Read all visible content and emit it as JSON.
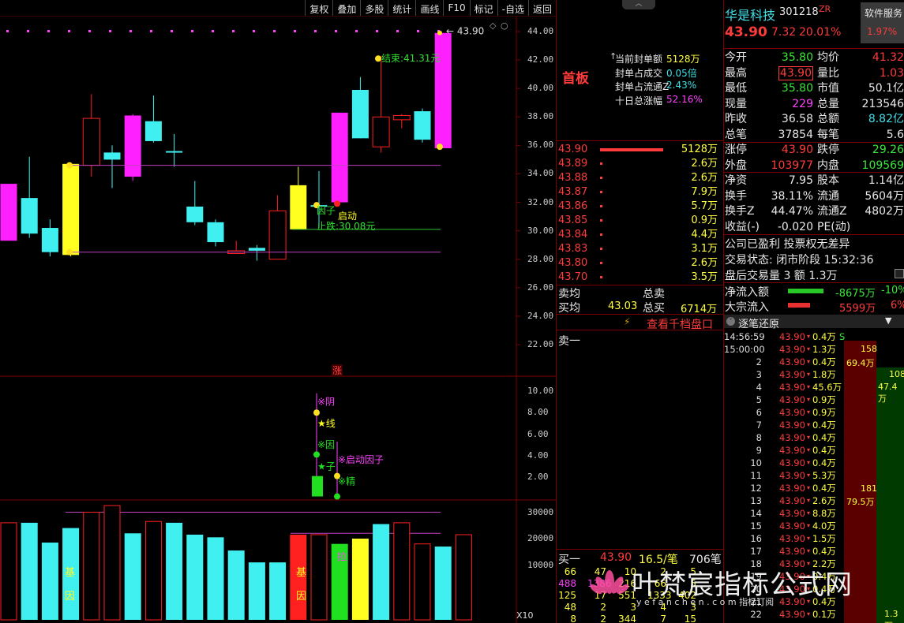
{
  "toolbar": {
    "items": [
      "复权",
      "叠加",
      "多股",
      "统计",
      "画线",
      "F10",
      "标记",
      "-自选",
      "返回"
    ]
  },
  "chart_data": [
    {
      "type": "candlestick",
      "name": "price",
      "yticks": [
        "44.00",
        "42.00",
        "40.00",
        "38.00",
        "36.00",
        "34.00",
        "32.00",
        "30.00",
        "28.00",
        "26.00",
        "24.00",
        "22.00"
      ],
      "ylim": [
        21.0,
        45.5
      ],
      "candles": [
        {
          "o": 33.3,
          "h": 33.3,
          "l": 29.3,
          "c": 29.3,
          "color": "magenta"
        },
        {
          "o": 29.8,
          "h": 35.2,
          "l": 29.5,
          "c": 32.3,
          "color": "cyan"
        },
        {
          "o": 28.5,
          "h": 30.8,
          "l": 28.2,
          "c": 30.2,
          "color": "cyan"
        },
        {
          "o": 28.3,
          "h": 34.8,
          "l": 28.2,
          "c": 34.7,
          "color": "yellow"
        },
        {
          "o": 34.6,
          "h": 39.6,
          "l": 33.8,
          "c": 37.9,
          "color": "red"
        },
        {
          "o": 35.0,
          "h": 36.0,
          "l": 33.0,
          "c": 35.5,
          "color": "cyan"
        },
        {
          "o": 33.8,
          "h": 38.2,
          "l": 33.5,
          "c": 38.1,
          "color": "magenta"
        },
        {
          "o": 36.3,
          "h": 39.5,
          "l": 36.2,
          "c": 37.7,
          "color": "cyan"
        },
        {
          "o": 35.6,
          "h": 36.8,
          "l": 34.5,
          "c": 35.5,
          "color": "cyan"
        },
        {
          "o": 30.6,
          "h": 33.5,
          "l": 30.4,
          "c": 31.7,
          "color": "cyan"
        },
        {
          "o": 29.2,
          "h": 30.8,
          "l": 28.9,
          "c": 30.6,
          "color": "cyan"
        },
        {
          "o": 28.4,
          "h": 29.3,
          "l": 28.4,
          "c": 28.6,
          "color": "red"
        },
        {
          "o": 28.6,
          "h": 29.0,
          "l": 27.9,
          "c": 28.8,
          "color": "cyan"
        },
        {
          "o": 28.0,
          "h": 32.5,
          "l": 28.0,
          "c": 31.4,
          "color": "red"
        },
        {
          "o": 30.1,
          "h": 34.5,
          "l": 30.1,
          "c": 33.2,
          "color": "yellow"
        },
        {
          "o": 31.8,
          "h": 34.2,
          "l": 30.2,
          "c": 31.8,
          "color": "cyan"
        },
        {
          "o": 32.0,
          "h": 38.3,
          "l": 32.0,
          "c": 38.3,
          "color": "magenta"
        },
        {
          "o": 36.5,
          "h": 40.8,
          "l": 36.5,
          "c": 39.9,
          "color": "cyan"
        },
        {
          "o": 35.9,
          "h": 42.3,
          "l": 35.5,
          "c": 38.0,
          "color": "red"
        },
        {
          "o": 37.8,
          "h": 38.2,
          "l": 37.2,
          "c": 38.1,
          "color": "red"
        },
        {
          "o": 36.4,
          "h": 38.6,
          "l": 36.2,
          "c": 38.4,
          "color": "cyan"
        },
        {
          "o": 35.8,
          "h": 43.9,
          "l": 35.8,
          "c": 43.9,
          "color": "magenta"
        }
      ],
      "hlines": [
        {
          "y": 34.6,
          "color": "#c040c0"
        },
        {
          "y": 28.5,
          "color": "#c040c0"
        },
        {
          "y": 30.1,
          "color": "#30c030"
        }
      ],
      "annotations": {
        "end": "结束:41.31元",
        "start": "启动",
        "factor": "因子",
        "stop": "止跌:30.08元",
        "last": "43.90",
        "zhang": "涨"
      }
    },
    {
      "type": "indicator",
      "name": "signal",
      "yticks": [
        "10.00",
        "8.00",
        "6.00",
        "4.00",
        "2.00"
      ],
      "ylim": [
        -0.2,
        11.2
      ],
      "labels": [
        "※阴",
        "★线",
        "※因",
        "★子",
        "※启动因子",
        "※精"
      ],
      "bars": [
        {
          "i": 15,
          "v": 2.1
        }
      ]
    },
    {
      "type": "bar",
      "name": "volume",
      "yticks": [
        "30000",
        "20000",
        "10000"
      ],
      "ylim": [
        0,
        33000
      ],
      "values": [
        26000,
        26000,
        18500,
        24000,
        30000,
        32500,
        22000,
        26500,
        26000,
        21500,
        20500,
        15500,
        11000,
        11000,
        21500,
        21500,
        18000,
        20000,
        25500,
        26000,
        18000,
        17000,
        21500
      ],
      "colors": [
        "red",
        "cyan",
        "cyan",
        "cyan",
        "red",
        "red",
        "cyan",
        "red",
        "cyan",
        "cyan",
        "cyan",
        "cyan",
        "cyan",
        "cyan",
        "red",
        "red",
        "green",
        "yellow",
        "cyan",
        "red",
        "red",
        "cyan",
        "red"
      ],
      "gene_label": [
        "基",
        "因"
      ],
      "la_label": "拉",
      "x10": "X10"
    }
  ],
  "panel": {
    "shouban": "首板",
    "seal": {
      "rows": [
        {
          "label": "当前封单额",
          "value": "5128万",
          "vcolor": "y"
        },
        {
          "label": "封单占成交",
          "value": "0.05倍",
          "vcolor": "c"
        },
        {
          "label": "封单占流通Z",
          "value": "2.43%",
          "vcolor": "c"
        },
        {
          "label": "十日总涨幅",
          "value": "52.16%",
          "vcolor": "m"
        }
      ]
    }
  },
  "orderbook": {
    "sell": [
      {
        "p": "43.90",
        "v": "5128万"
      },
      {
        "p": "43.89",
        "v": "2.6万"
      },
      {
        "p": "43.88",
        "v": "2.6万"
      },
      {
        "p": "43.87",
        "v": "7.9万"
      },
      {
        "p": "43.86",
        "v": "5.7万"
      },
      {
        "p": "43.85",
        "v": "0.9万"
      },
      {
        "p": "43.84",
        "v": "4.4万"
      },
      {
        "p": "43.83",
        "v": "3.1万"
      },
      {
        "p": "43.80",
        "v": "2.6万"
      },
      {
        "p": "43.70",
        "v": "3.5万"
      }
    ],
    "maijun": "卖均",
    "zongmai": "总卖",
    "mai_jun": "买均",
    "mai_jun_val": "43.03",
    "zongmai2": "总买",
    "zongmai2_val": "6714万",
    "qiandang": "查看千档盘口",
    "maiyi": "卖一",
    "buy1": {
      "label": "买一",
      "price": "43.90",
      "avg": "16.5/笔",
      "count": "706笔"
    },
    "queue": [
      [
        "66",
        "47",
        "10",
        "2",
        "5"
      ],
      [
        "488",
        "1386",
        "216",
        "66",
        "5"
      ],
      [
        "125",
        "17",
        "551",
        "1333",
        "402"
      ],
      [
        "48",
        "2",
        "3",
        "4",
        "3"
      ],
      [
        "8",
        "2",
        "344",
        "7",
        "15"
      ]
    ]
  },
  "quote": {
    "name": "华是科技",
    "code": "301218",
    "tag": "ZR",
    "sector": "软件服务",
    "sector_pct": "1.97%",
    "price": "43.90",
    "chg": "7.32",
    "pct": "20.01%",
    "rows": [
      [
        [
          "今开",
          "w"
        ],
        [
          "35.80",
          "g"
        ],
        [
          "均价",
          "w"
        ],
        [
          "41.32",
          "r"
        ]
      ],
      [
        [
          "最高",
          "w"
        ],
        [
          "43.90",
          "r"
        ],
        [
          "量比",
          "w"
        ],
        [
          "1.03",
          "r"
        ]
      ],
      [
        [
          "最低",
          "w"
        ],
        [
          "35.80",
          "g"
        ],
        [
          "市值",
          "w"
        ],
        [
          "50.1亿",
          "w"
        ]
      ],
      [
        [
          "现量",
          "w"
        ],
        [
          "229",
          "m"
        ],
        [
          "总量",
          "w"
        ],
        [
          "213546",
          "w"
        ]
      ],
      [
        [
          "昨收",
          "w"
        ],
        [
          "36.58",
          "w"
        ],
        [
          "总额",
          "w"
        ],
        [
          "8.82亿",
          "c"
        ]
      ],
      [
        [
          "总笔",
          "w"
        ],
        [
          "37854",
          "w"
        ],
        [
          "每笔",
          "w"
        ],
        [
          "5.6",
          "w"
        ]
      ]
    ],
    "rows2": [
      [
        [
          "涨停",
          "w"
        ],
        [
          "43.90",
          "r"
        ],
        [
          "跌停",
          "w"
        ],
        [
          "29.26",
          "g"
        ]
      ],
      [
        [
          "外盘",
          "w"
        ],
        [
          "103977",
          "r"
        ],
        [
          "内盘",
          "w"
        ],
        [
          "109569",
          "g"
        ]
      ]
    ],
    "rows3": [
      [
        [
          "净资",
          "w"
        ],
        [
          "7.95",
          "w"
        ],
        [
          "股本",
          "w"
        ],
        [
          "1.14亿",
          "w"
        ]
      ],
      [
        [
          "换手",
          "w"
        ],
        [
          "38.11%",
          "w"
        ],
        [
          "流通",
          "w"
        ],
        [
          "5604万",
          "w"
        ]
      ],
      [
        [
          "换手Z",
          "w"
        ],
        [
          "44.47%",
          "w"
        ],
        [
          "流通Z",
          "w"
        ],
        [
          "4802万",
          "w"
        ]
      ],
      [
        [
          "收益(-)",
          "w"
        ],
        [
          "-0.020",
          "w"
        ],
        [
          "PE(动)",
          "w"
        ],
        [
          "",
          "w"
        ]
      ]
    ],
    "info1": "公司已盈利 投票权无差异",
    "info2": "交易状态: 闭市阶段 15:32:36",
    "info3": "盘后交易量 3 额 1.3万",
    "netflow": {
      "label": "净流入额",
      "value": "-8675万",
      "pct": "-10%"
    },
    "blockflow": {
      "label": "大宗流入",
      "value": "5599万",
      "pct": "6%"
    },
    "tick_title": "逐笔还原",
    "ticks": [
      [
        "14:56:59",
        "43.90",
        "0.4万",
        "S"
      ],
      [
        "15:00:00",
        "43.90",
        "1.3万",
        ""
      ],
      [
        "2",
        "43.90",
        "0.4万",
        ""
      ],
      [
        "3",
        "43.90",
        "1.8万",
        ""
      ],
      [
        "4",
        "43.90",
        "45.6万",
        ""
      ],
      [
        "5",
        "43.90",
        "0.9万",
        ""
      ],
      [
        "6",
        "43.90",
        "0.9万",
        ""
      ],
      [
        "7",
        "43.90",
        "0.4万",
        ""
      ],
      [
        "8",
        "43.90",
        "0.4万",
        ""
      ],
      [
        "9",
        "43.90",
        "0.4万",
        ""
      ],
      [
        "10",
        "43.90",
        "0.4万",
        ""
      ],
      [
        "11",
        "43.90",
        "5.3万",
        ""
      ],
      [
        "12",
        "43.90",
        "0.4万",
        ""
      ],
      [
        "13",
        "43.90",
        "2.6万",
        ""
      ],
      [
        "14",
        "43.90",
        "8.8万",
        ""
      ],
      [
        "15",
        "43.90",
        "4.0万",
        ""
      ],
      [
        "16",
        "43.90",
        "1.5万",
        ""
      ],
      [
        "17",
        "43.90",
        "0.4万",
        ""
      ],
      [
        "18",
        "43.90",
        "2.2万",
        ""
      ],
      [
        "19",
        "43.90",
        "0.4万",
        ""
      ],
      [
        "20",
        "43.90",
        "0.4万",
        ""
      ],
      [
        "21",
        "43.90",
        "0.4万",
        ""
      ],
      [
        "22",
        "43.90",
        "0.1万",
        ""
      ]
    ],
    "big1": {
      "a": "158",
      "b": "69.4万"
    },
    "big2": {
      "a": "108",
      "b": "47.4万"
    },
    "big3": {
      "a": "181",
      "b": "79.5万"
    },
    "big4": "1.3万"
  },
  "watermark": {
    "main": "叶梵宸指标公式网",
    "sub": "y e f a n c h e n . c o m   指标订阅"
  }
}
